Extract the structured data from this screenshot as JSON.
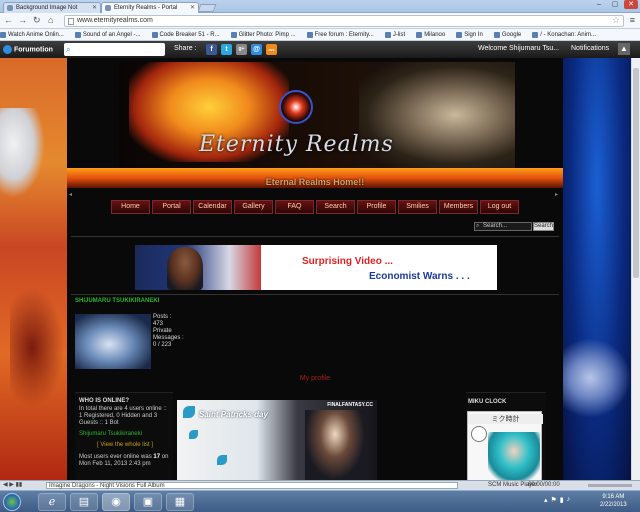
{
  "browser": {
    "tabs": [
      {
        "label": "Background Image Not ",
        "active": false
      },
      {
        "label": "Eternity Realms - Portal",
        "active": true
      }
    ],
    "url": "www.eternityrealms.com",
    "bookmarks": [
      "Watch Anime Onlin...",
      "Sound of an Angel -...",
      "Code Breaker 51 - R...",
      "Glitter Photo: Pimp ...",
      "Free forum : Eternity...",
      "J-list",
      "Milanoo",
      "Sign In",
      "Google",
      "/ - Konachan: Anim..."
    ]
  },
  "forumbar": {
    "logo": "Forumotion",
    "share_label": "Share :",
    "social": [
      "f",
      "t",
      "g+",
      "@",
      "rss"
    ],
    "welcome": "Welcome Shijumaru Tsu...",
    "notifications": "Notifications"
  },
  "site": {
    "banner_title": "Eternity Realms",
    "subtitle": "Eternal Realms Home!!",
    "nav": [
      "Home",
      "Portal",
      "Calendar",
      "Gallery",
      "FAQ",
      "Search",
      "Profile",
      "Smilies",
      "Members",
      "Log out"
    ],
    "search_placeholder": "Search...",
    "search_button": "Search"
  },
  "ad": {
    "line1": "Surprising Video ...",
    "line2": "Economist Warns . . ."
  },
  "user": {
    "name": "SHIJUMARU TSUKIKIRANEKI",
    "posts_label": "Posts :",
    "posts": "473",
    "pm_label": "Private Messages :",
    "pm": "0 / 223",
    "profile_link": "My profile"
  },
  "who_online": {
    "title": "WHO IS ONLINE?",
    "summary": "In total there are 4 users online :: 1 Registered, 0 Hidden and 3 Guests :: 1 Bot",
    "online_user": "Shijumaru Tsukikiraneki",
    "view_list": "[ View the whole list ]",
    "record": "Most users ever online was ",
    "record_count": "17",
    "record_date": " on Mon Feb 11, 2013 2:43 pm"
  },
  "graphic": {
    "caption": "Saint Patricks day",
    "brand": "FINALFANTASY.CC"
  },
  "clock": {
    "title": "MIKU CLOCK",
    "caption": "ミク時計"
  },
  "status_bar": {
    "media": "Imagine Dragons - Night Visions Full Album",
    "player": "SCM Music Player",
    "time": "00:00/00:00"
  },
  "taskbar": {
    "time": "9:16 AM",
    "date": "2/22/2013"
  },
  "colors": {
    "forumbar_bg": "#1a1a1a",
    "accent_red": "#e02020",
    "accent_blue": "#1a3a9a",
    "username_green": "#2fb32f"
  }
}
